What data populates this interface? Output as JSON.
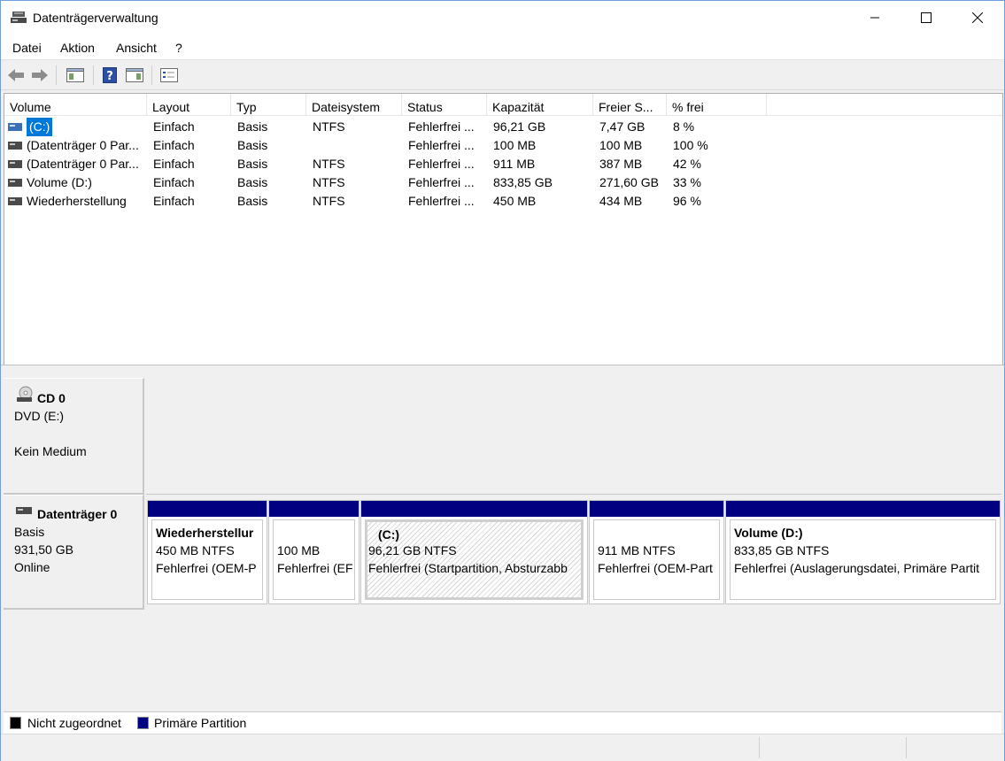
{
  "window": {
    "title": "Datenträgerverwaltung"
  },
  "menu": {
    "items": [
      "Datei",
      "Aktion",
      "Ansicht",
      "?"
    ]
  },
  "toolbar": {
    "icons": [
      "back-arrow-icon",
      "forward-arrow-icon",
      "show-hide-console-tree-icon",
      "help-icon",
      "show-action-pane-icon",
      "properties-icon"
    ]
  },
  "volume_list": {
    "columns": [
      "Volume",
      "Layout",
      "Typ",
      "Dateisystem",
      "Status",
      "Kapazität",
      "Freier S...",
      "% frei"
    ],
    "rows": [
      {
        "volume": "(C:)",
        "layout": "Einfach",
        "type": "Basis",
        "fs": "NTFS",
        "status": "Fehlerfrei ...",
        "capacity": "96,21 GB",
        "free": "7,47 GB",
        "pct": "8 %",
        "selected": true
      },
      {
        "volume": "(Datenträger 0 Par...",
        "layout": "Einfach",
        "type": "Basis",
        "fs": "",
        "status": "Fehlerfrei ...",
        "capacity": "100 MB",
        "free": "100 MB",
        "pct": "100 %",
        "selected": false
      },
      {
        "volume": "(Datenträger 0 Par...",
        "layout": "Einfach",
        "type": "Basis",
        "fs": "NTFS",
        "status": "Fehlerfrei ...",
        "capacity": "911 MB",
        "free": "387 MB",
        "pct": "42 %",
        "selected": false
      },
      {
        "volume": "Volume (D:)",
        "layout": "Einfach",
        "type": "Basis",
        "fs": "NTFS",
        "status": "Fehlerfrei ...",
        "capacity": "833,85 GB",
        "free": "271,60 GB",
        "pct": "33 %",
        "selected": false
      },
      {
        "volume": "Wiederherstellung",
        "layout": "Einfach",
        "type": "Basis",
        "fs": "NTFS",
        "status": "Fehlerfrei ...",
        "capacity": "450 MB",
        "free": "434 MB",
        "pct": "96 %",
        "selected": false
      }
    ]
  },
  "cd0": {
    "title": "CD 0",
    "line1": "DVD (E:)",
    "line2": "Kein Medium"
  },
  "disk0": {
    "title": "Datenträger 0",
    "line1": "Basis",
    "line2": "931,50 GB",
    "line3": "Online",
    "partitions": [
      {
        "name": "Wiederherstellur",
        "size": "450 MB NTFS",
        "status": "Fehlerfrei (OEM-P"
      },
      {
        "name": "",
        "size": "100 MB",
        "status": "Fehlerfrei (EF"
      },
      {
        "name": "(C:)",
        "size": "96,21 GB NTFS",
        "status": "Fehlerfrei (Startpartition, Absturzabb"
      },
      {
        "name": "",
        "size": "911 MB NTFS",
        "status": "Fehlerfrei (OEM-Part"
      },
      {
        "name": "Volume  (D:)",
        "size": "833,85 GB NTFS",
        "status": "Fehlerfrei (Auslagerungsdatei, Primäre Partit"
      }
    ]
  },
  "legend": {
    "unallocated": "Nicht zugeordnet",
    "unallocated_color": "#000000",
    "primary": "Primäre Partition",
    "primary_color": "#000080"
  }
}
